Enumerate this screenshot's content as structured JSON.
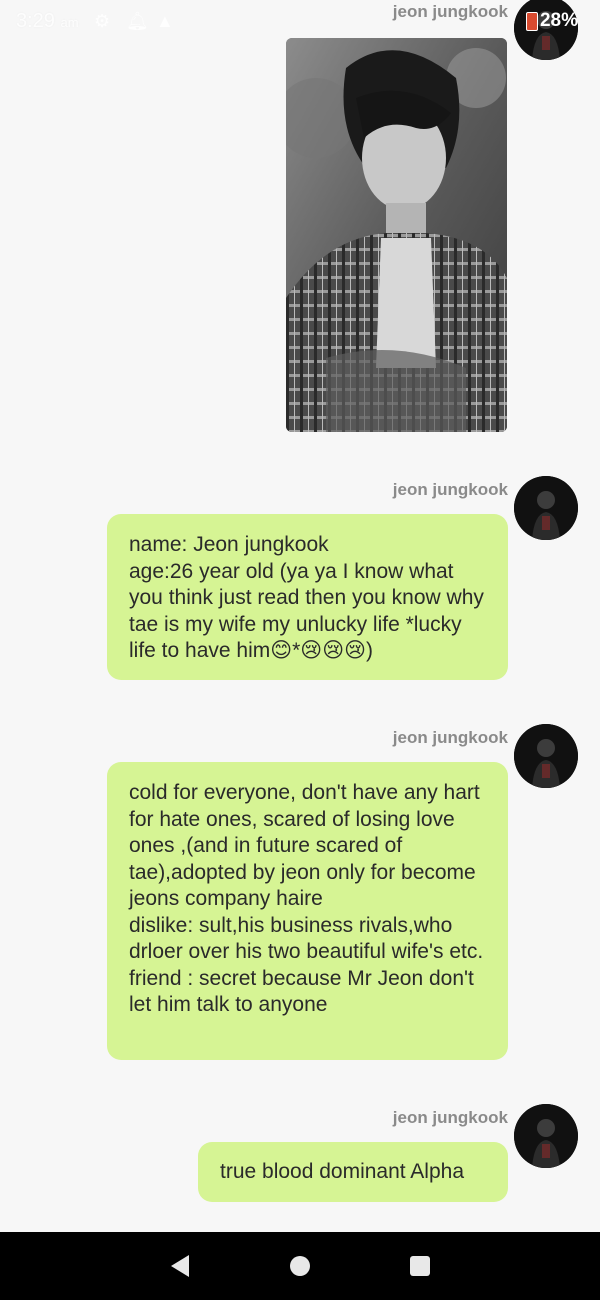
{
  "status_bar": {
    "time": "3:29",
    "time_suffix": "am",
    "battery": "28%"
  },
  "messages": [
    {
      "sender": "jeon jungkook",
      "type": "image"
    },
    {
      "sender": "jeon jungkook",
      "type": "text",
      "text": "name: Jeon jungkook\nage:26 year old (ya ya I know what you think just read then you know why tae is my wife my unlucky life *lucky life to have him😊*😢😢😢)"
    },
    {
      "sender": "jeon jungkook",
      "type": "text",
      "text": "cold for everyone, don't have any hart for hate ones, scared of losing love ones ,(and in future scared of tae),adopted by jeon only for become jeons company haire\ndislike: sult,his business rivals,who drloer over his two beautiful wife's etc.\nfriend : secret because Mr Jeon don't let him talk to anyone"
    },
    {
      "sender": "jeon jungkook",
      "type": "text",
      "text": "true blood dominant Alpha"
    }
  ],
  "colors": {
    "bubble": "#d6f494",
    "background": "#f7f7f7",
    "sender": "#8a8a8a",
    "nav_bar": "#000000"
  },
  "icons": {
    "status": [
      "gear-icon",
      "notification-icon",
      "warning-icon",
      "battery-icon"
    ],
    "nav": [
      "back-icon",
      "home-icon",
      "recents-icon"
    ]
  }
}
